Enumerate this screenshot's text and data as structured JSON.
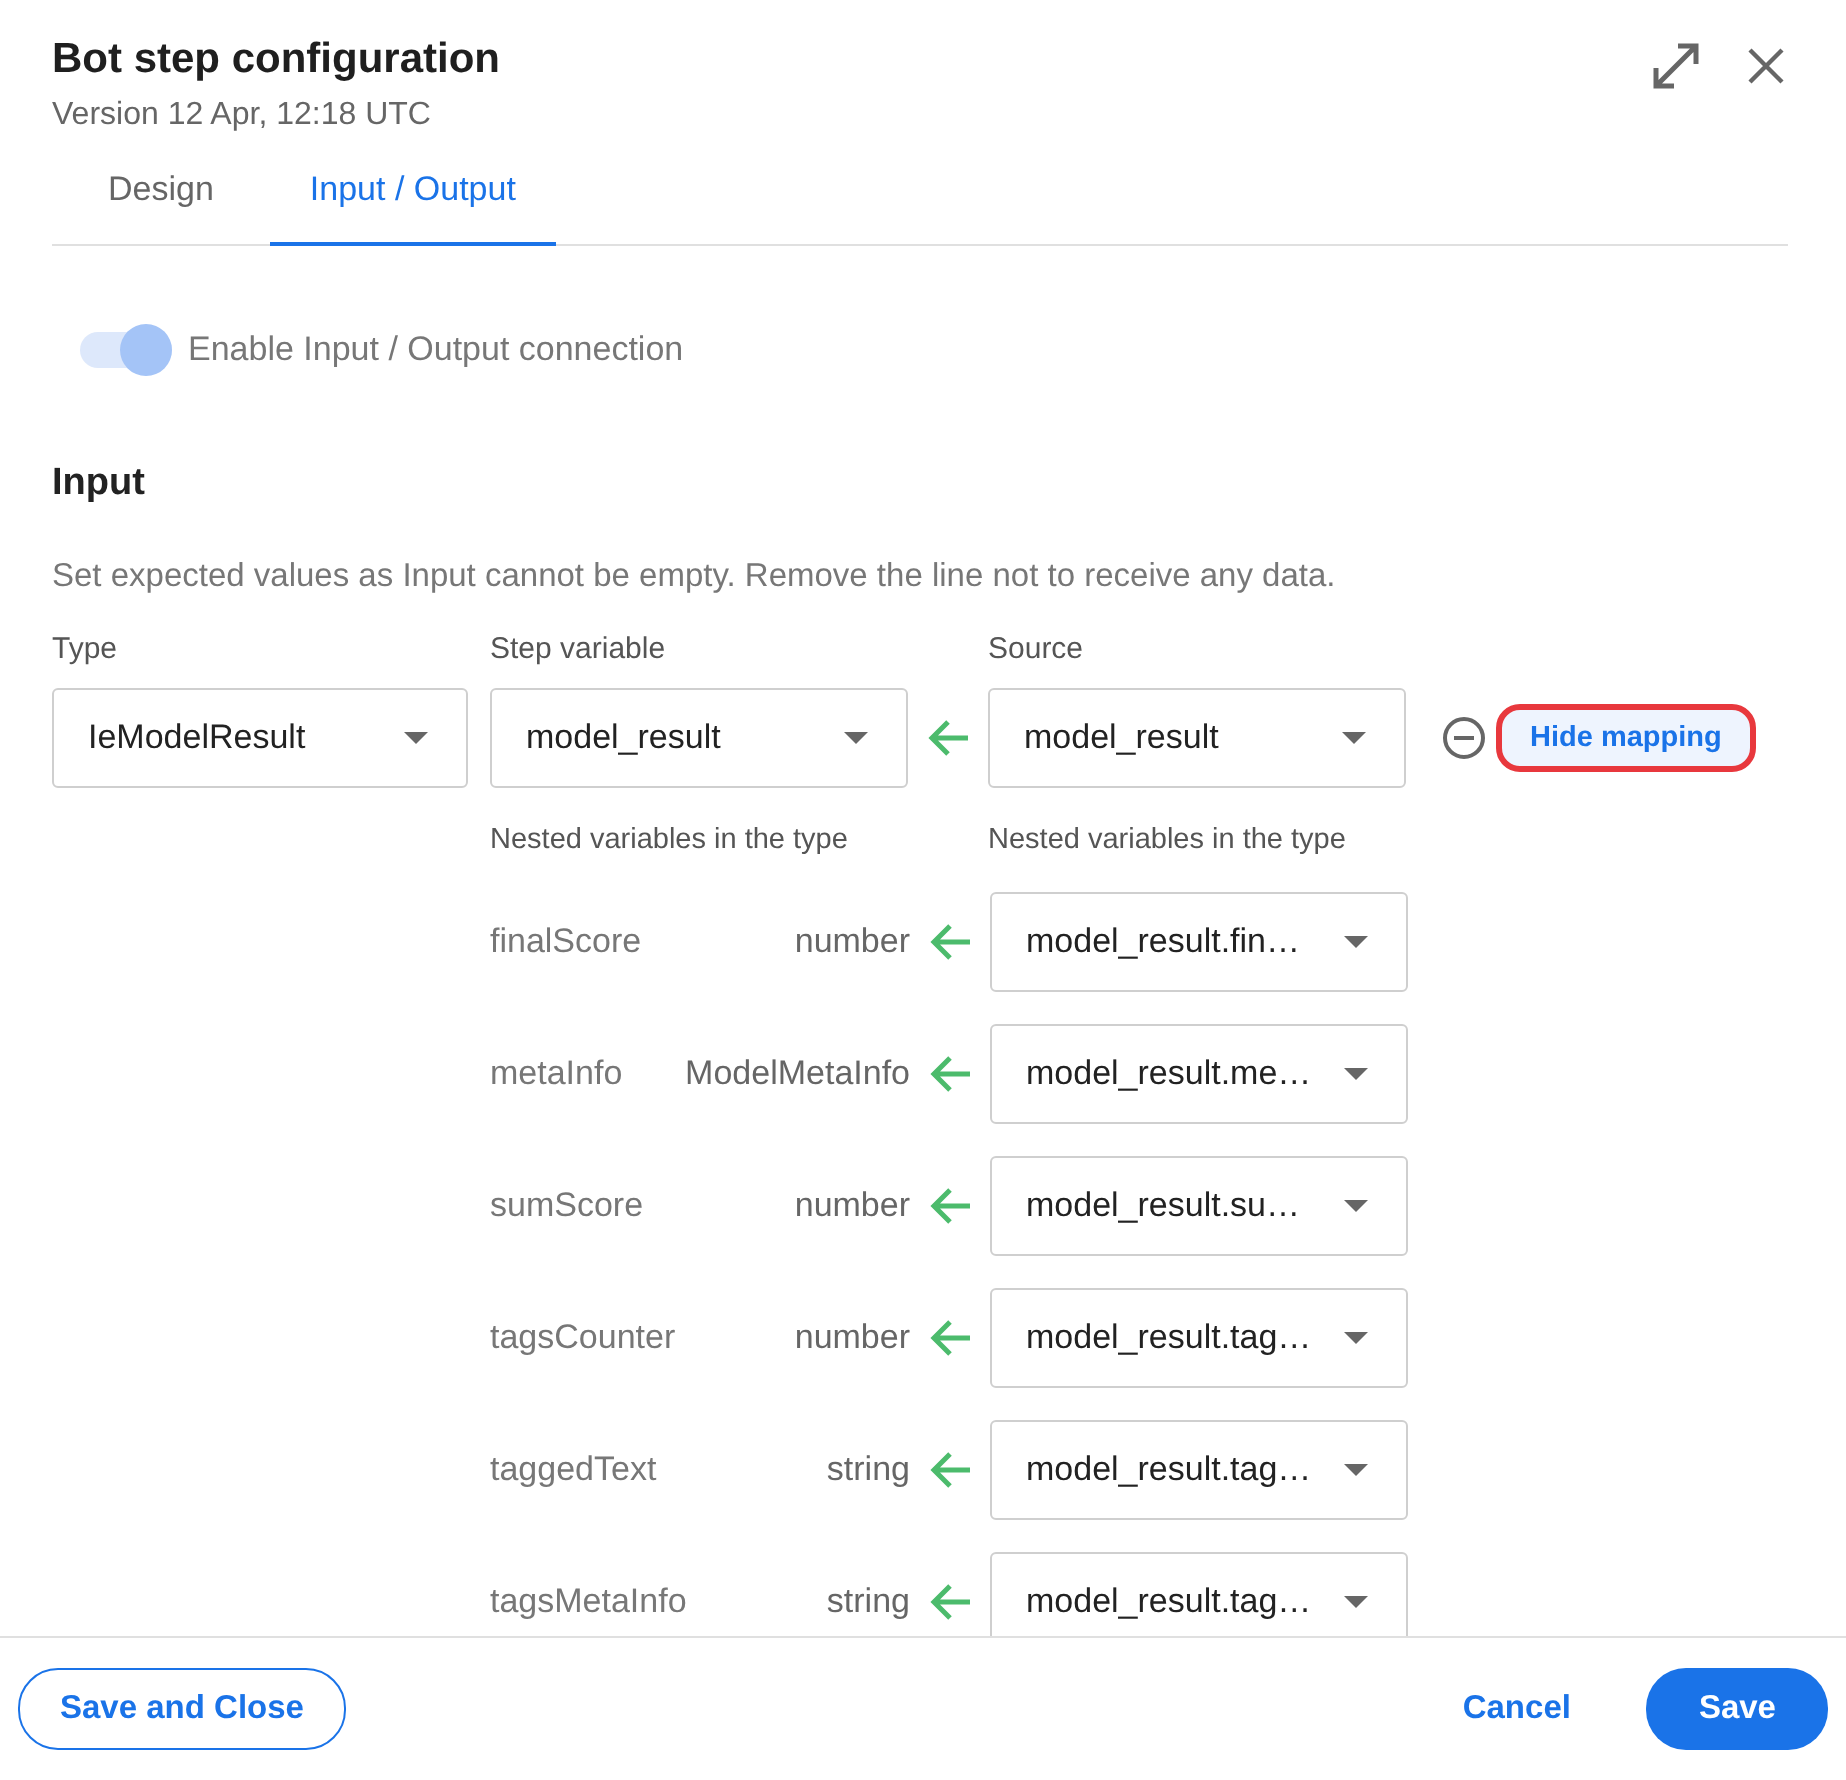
{
  "header": {
    "title": "Bot step configuration",
    "version": "Version 12 Apr, 12:18 UTC"
  },
  "tabs": [
    {
      "label": "Design",
      "selected": false
    },
    {
      "label": "Input / Output",
      "selected": true
    }
  ],
  "toggle": {
    "label": "Enable Input / Output connection",
    "on": true
  },
  "input": {
    "heading": "Input",
    "description": "Set expected values as Input cannot be empty. Remove the line not to receive any data.",
    "columns": [
      "Type",
      "Step variable",
      "Source"
    ],
    "row": {
      "type": "IeModelResult",
      "step_variable": "model_result",
      "source": "model_result",
      "toggle_label": "Hide mapping"
    },
    "nested_labels": [
      "Nested variables in the type",
      "Nested variables in the type"
    ],
    "nested": [
      {
        "name": "finalScore",
        "type": "number",
        "source": "model_result.fin…"
      },
      {
        "name": "metaInfo",
        "type": "ModelMetaInfo",
        "source": "model_result.me…"
      },
      {
        "name": "sumScore",
        "type": "number",
        "source": "model_result.su…"
      },
      {
        "name": "tagsCounter",
        "type": "number",
        "source": "model_result.tag…"
      },
      {
        "name": "taggedText",
        "type": "string",
        "source": "model_result.tag…"
      },
      {
        "name": "tagsMetaInfo",
        "type": "string",
        "source": "model_result.tag…"
      }
    ]
  },
  "footer": {
    "save_close": "Save and Close",
    "cancel": "Cancel",
    "save": "Save"
  }
}
